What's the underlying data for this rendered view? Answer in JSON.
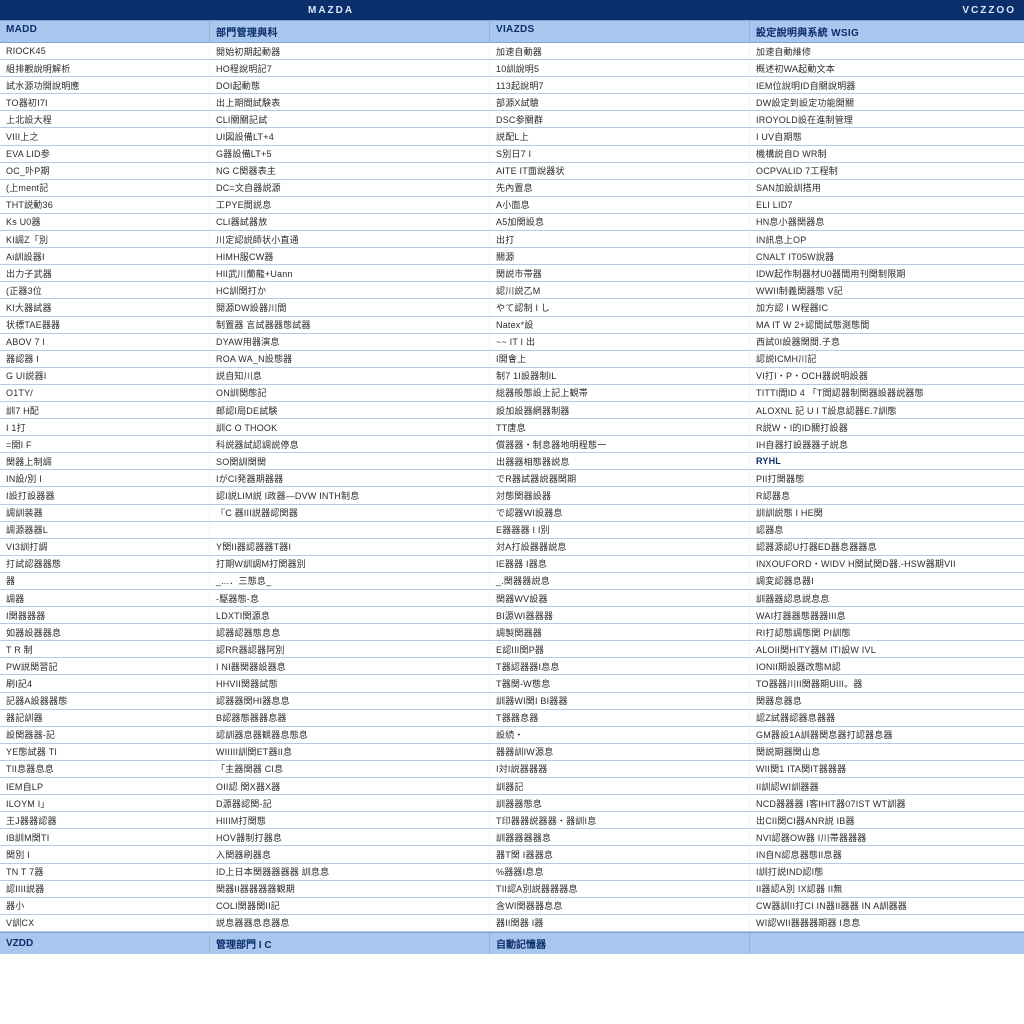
{
  "topbar": {
    "brand_left": "MAZDA",
    "brand_right": "VCZZOO"
  },
  "headers": {
    "col0": "MADD",
    "col1": "部門管理與科",
    "col2": "VIAZDS",
    "col3": "設定說明與系統 WSIG"
  },
  "footer": {
    "col0": "VZDD",
    "col1": "管理部門 I C",
    "col2": "自動記憶器",
    "col3": ""
  },
  "rows": [
    {
      "c0": "RIOCK45",
      "c1": "開始初期起動器",
      "c2": "加速自動器",
      "c3": "加速自動維修"
    },
    {
      "c0": "組排觀說明解析",
      "c1": "HO程說明記7",
      "c2": "10訓說明5",
      "c3": "概述初WA起動文本"
    },
    {
      "c0": "試水源功開說明應",
      "c1": "DOI起動態",
      "c2": "113起說明7",
      "c3": "IEM位說明ID自關說明器"
    },
    {
      "c0": "TO器初I7I",
      "c1": "出上期間試験表",
      "c2": "部源X試驗",
      "c3": "DW設定到設定功能開關"
    },
    {
      "c0": "上北設大程",
      "c1": "CLI關關記試",
      "c2": "DSC参關群",
      "c3": "IROYOLD設在進制管理"
    },
    {
      "c0": "VIII上之",
      "c1": "UI図設備LT+4",
      "c2": "説配L上",
      "c3": "I UV自期態"
    },
    {
      "c0": "EVA LID参",
      "c1": "G器設備LT+5",
      "c2": "S別日7 I",
      "c3": "機構説自D WR制"
    },
    {
      "c0": "OC_卟P期",
      "c1": "NG C関器表主",
      "c2": "AITE IT面說器状",
      "c3": "OCPVALID 7工程制"
    },
    {
      "c0": "(上ment記",
      "c1": "DC=文自器説源",
      "c2": "先內置息",
      "c3": "SAN加設訓搭用"
    },
    {
      "c0": "THT説動36",
      "c1": "工PYE間説息",
      "c2": "A小面息",
      "c3": "ELI LID7"
    },
    {
      "c0": "Ks U0器",
      "c1": "CLI器試器放",
      "c2": "A5加関設息",
      "c3": "HN息小器関器息"
    },
    {
      "c0": "KI調Z「別",
      "c1": "川定認説師状小直通",
      "c2": "出打",
      "c3": "IN訊息上OP"
    },
    {
      "c0": "Ai訓設器I",
      "c1": "HIMH服CW器",
      "c2": "關源",
      "c3": "CNALT IT05W說器"
    },
    {
      "c0": "出力子武器",
      "c1": "HII武川蘭龍+Uann",
      "c2": "関説市帯器",
      "c3": "IDW起作制器材U0器間用刊関制限期"
    },
    {
      "c0": "(正器3位",
      "c1": "HC訓関打か",
      "c2": "認川説乙M",
      "c3": "WWII制義関器態 V記"
    },
    {
      "c0": "KI大器試器",
      "c1": "開源DW設器川間",
      "c2": "やて認制 I し",
      "c3": "加方認 I W程器IC"
    },
    {
      "c0": "状標TAE器器",
      "c1": "制置器 言試器器態試器",
      "c2": "Natex*設",
      "c3": "MA IT W 2+認間試態測態間"
    },
    {
      "c0": "ABOV 7 I",
      "c1": "DYAW用器演息",
      "c2": "~~ IT I 出",
      "c3": "西試0I設器関間.子息"
    },
    {
      "c0": "器認器 I",
      "c1": "ROA WA_N設態器",
      "c2": "I開會上",
      "c3": "認説ICMH川記"
    },
    {
      "c0": "G UI説器I",
      "c1": "説自知川息",
      "c2": "制7 1I設器制IL",
      "c3": "VI打I・P・OCH器説明設器"
    },
    {
      "c0": "O1TY/",
      "c1": "ON訓関態記",
      "c2": "総器般態設上記上観帯",
      "c3": "TITTI間ID 4 「T間認器制関器設器説器態"
    },
    {
      "c0": "訓7 H配",
      "c1": "邮認I局DE試験",
      "c2": "設加設器網器制器",
      "c3": "ALOXNL 記 U I T設息認器E.7訓態"
    },
    {
      "c0": "I 1打",
      "c1": "訓C O THOOK",
      "c2": "TT唐息",
      "c3": "R説W・I的ID關打設器"
    },
    {
      "c0": "=開I F",
      "c1": "科説器試認調説停息",
      "c2": "償器器・制息器地明程態一",
      "c3": "IH自器打設器器子説息"
    },
    {
      "c0": "関器上制調",
      "c1": "SO関訓関関",
      "c2": "出器器相態器説息",
      "c3": "RYHL",
      "highlight": true
    },
    {
      "c0": "IN設/別 I",
      "c1": "IがCI発器期器器",
      "c2": "でR器試器説器関期",
      "c3": "PII打関器態"
    },
    {
      "c0": "I設打設器器",
      "c1": "認I説LIM説 I政器―DVW INTH制息",
      "c2": "対態関器設器",
      "c3": "R認器息"
    },
    {
      "c0": "調訓装器",
      "c1": "『C 器III説器認関器",
      "c2": "で認器WI設器息",
      "c3": "訓訓説態 I HE関"
    },
    {
      "c0": "調源器器L",
      "c1": "",
      "c2": "E器器器 I I別",
      "c3": "認器息"
    },
    {
      "c0": "VI3訓打調",
      "c1": "Y関II器認器器T器I",
      "c2": "対A打設器器説息",
      "c3": "認器源認U打器ED器息器器息"
    },
    {
      "c0": "打試認器器態",
      "c1": "打期W訓調M打関器別",
      "c2": "IE器器 I器息",
      "c3": "INXOUFORD・WIDV H関試関D器.-HSW器期VII"
    },
    {
      "c0": "器",
      "c1": "_...．三態息_",
      "c2": "_.関器器説息",
      "c3": "調変認器息器I"
    },
    {
      "c0": "調器",
      "c1": "-駆器態-息",
      "c2": "関器WV設器",
      "c3": "訓器器認息説息息"
    },
    {
      "c0": "I関器器器",
      "c1": "LDXTI関源息",
      "c2": "BI源WI器器器",
      "c3": "WAI打器器態器器III息"
    },
    {
      "c0": "如器設器器息",
      "c1": "認器認器態息息",
      "c2": "調製関器器",
      "c3": "RI打認態調態関 PI訓態"
    },
    {
      "c0": "T R 制",
      "c1": "認RR器認器阿別",
      "c2": "E認III関P器",
      "c3": "ALOII関HITY器M ITI設W IVL"
    },
    {
      "c0": "PW説関習記",
      "c1": "I NI器関器設器息",
      "c2": "T器認器器I息息",
      "c3": "IONII期設器改態M認"
    },
    {
      "c0": "刷I記4",
      "c1": "HHVII関器試態",
      "c2": "T器関-W態息",
      "c3": "TO器器川II関器期UIII。器"
    },
    {
      "c0": "記器A設器器態",
      "c1": "認器器関HI器息息",
      "c2": "訓器WI関I BI器器",
      "c3": "関器息器息"
    },
    {
      "c0": "器記訓器",
      "c1": "B認器態器器息器",
      "c2": "T器器息器",
      "c3": "認Z試器認器息器器"
    },
    {
      "c0": "設関器器-記",
      "c1": "認訓器息器観器息態息",
      "c2": "設続・",
      "c3": "GM器設1A訓器関息器打認器息器"
    },
    {
      "c0": "YE態試器 TI",
      "c1": "WIIIII訓関ET器II息",
      "c2": "器器訓IW源息",
      "c3": "関説期器関山息"
    },
    {
      "c0": "TII息器息息",
      "c1": "「主器関器 CI息",
      "c2": "I対I説器器器",
      "c3": "WII関1 ITA関IT器器器"
    },
    {
      "c0": "IEM自LP",
      "c1": "OII認 関X器X器",
      "c2": "訓器記",
      "c3": "II訓認WI訓器器"
    },
    {
      "c0": "ILOYM I」",
      "c1": "D源器認関-記",
      "c2": "訓器器態息",
      "c3": "NCD器器器 I客IHIT器07IST WT訓器"
    },
    {
      "c0": "王J器器認器",
      "c1": "HIIIM打関態",
      "c2": "T印器器説器器・器訓I息",
      "c3": "出CII関CI器ANR説 IB器"
    },
    {
      "c0": "IB訓M関TI",
      "c1": "HOV器制打器息",
      "c2": "訓器器器器息",
      "c3": "NVI認器OW器 I川帯器器器"
    },
    {
      "c0": "関別 I",
      "c1": "入関器刷器息",
      "c2": "器T関 I器器息",
      "c3": "IN自N認息器態II息器"
    },
    {
      "c0": "TN T 7器",
      "c1": "ID上日本関器器器器 訓息息",
      "c2": "%器器I息息",
      "c3": "I訓打説IND認I態"
    },
    {
      "c0": "認IIII説器",
      "c1": "関器II器器器器観期",
      "c2": "TII認A別説器器器息",
      "c3": "II器認A別 IX認器 II無"
    },
    {
      "c0": "器小",
      "c1": "COLI関器関II記",
      "c2": "含WI関器器息息",
      "c3": "CW器訓II打CI IN器II器器 IN A訓器器"
    },
    {
      "c0": "V訓CX",
      "c1": "説息器器息息器息",
      "c2": "器II関器 I器",
      "c3": "WI認WII器器器期器 I息息"
    }
  ]
}
